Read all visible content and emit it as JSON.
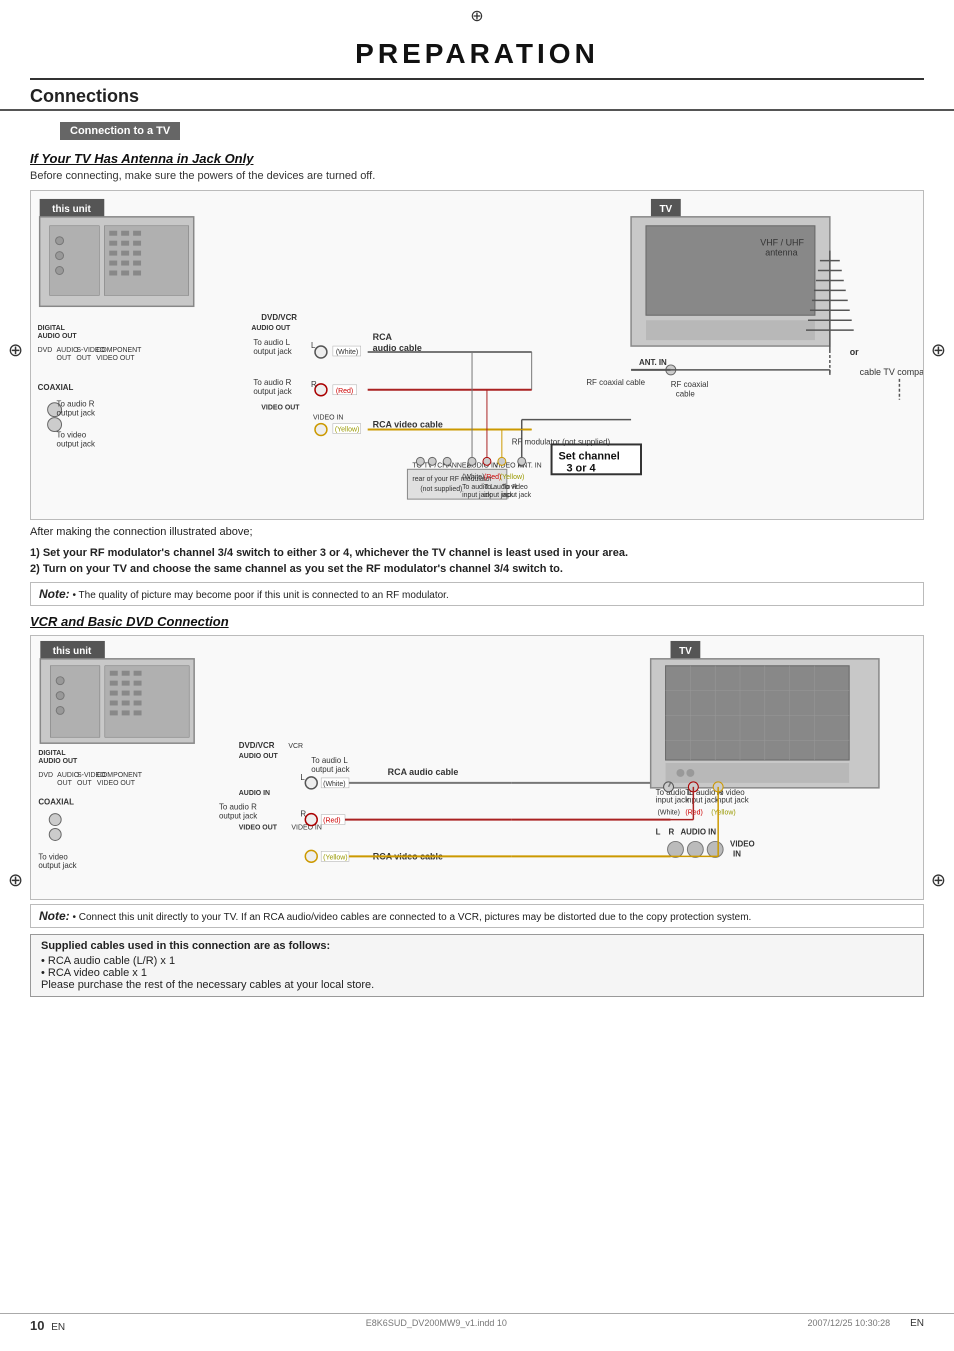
{
  "page": {
    "title": "PREPARATION",
    "registration_mark": "⊕"
  },
  "connections": {
    "heading": "Connections",
    "section_bar": "Connection to a TV",
    "section1": {
      "heading": "If Your TV Has Antenna in Jack Only",
      "subtitle": "Before connecting, make sure the powers of the devices are turned off.",
      "this_unit_label": "this unit",
      "tv_label": "TV",
      "labels": {
        "audio_l_out": "To audio L\noutput jack",
        "audio_r_out": "To audio R\noutput jack",
        "video_out": "To video\noutput jack",
        "rca_audio": "RCA\naudio cable",
        "rca_video": "RCA video cable",
        "rf_coaxial": "RF coaxial\ncable",
        "rf_modulator": "RF modulator (not supplied)",
        "rf_coaxial_cable": "RF coaxial\ncable",
        "vhf_uhf": "VHF / UHF\nantenna",
        "cable_company": "cable TV company",
        "or": "or",
        "set_channel": "Set channel\n3 or 4",
        "rear_modulator": "rear of your RF modulator\n(not supplied)",
        "ant_in": "ANT. IN",
        "to_channel": "TO TV / CHANNEL",
        "audio_in": "AUDIO IN",
        "video_in": "VIDEO IN",
        "audio_l_input": "To audio L\ninput jack",
        "audio_r_input": "To audio R\ninput jack",
        "video_input": "To video\ninput jack",
        "white_badge": "(White)",
        "red_badge": "(Red)",
        "yellow_badge": "(Yellow)",
        "dvd": "DVD",
        "dvd_vcr": "DVD/VCR",
        "digital_audio_out": "DIGITAL\nAUDIO OUT",
        "audio_out": "AUDIO\nOUT",
        "s_video_out": "S-VIDEO\nOUT",
        "component_video": "COMPONENT\nVIDEO OUT",
        "coaxial": "COAXIAL",
        "audio_in_label": "AUDIO IN",
        "video_out_label": "VIDEO OUT",
        "video_in_label": "VIDEO IN",
        "l_label": "L",
        "r_label": "R"
      }
    },
    "after_text": "After making the connection illustrated above;",
    "step1": "1) Set your RF modulator's channel 3/4 switch to either 3 or 4, whichever the TV channel is least used in your area.",
    "step2": "2) Turn on your TV and choose the same channel as you set the RF modulator's channel 3/4 switch to.",
    "note1": {
      "label": "Note:",
      "text": "• The quality of picture may become poor if this unit is connected to an RF modulator."
    },
    "section2": {
      "heading": "VCR and Basic DVD Connection",
      "this_unit_label": "this unit",
      "tv_label": "TV",
      "labels": {
        "audio_l_out": "To audio L\noutput jack",
        "audio_r_out": "To audio R\noutput jack",
        "video_out": "To video\noutput jack",
        "rca_audio": "RCA audio cable",
        "rca_video": "RCA video cable",
        "to_audio_l_input": "To audio L\ninput jack",
        "to_audio_r_input": "To audio R\ninput jack",
        "to_video_input": "To video\ninput jack",
        "audio_in_l": "L",
        "audio_in_r": "R",
        "audio_in_label": "AUDIO IN",
        "video_in_label": "VIDEO\nIN",
        "dvd": "DVD",
        "dvd_vcr_vcr": "DVD/VCR  VCR",
        "digital_audio_out": "DIGITAL\nAUDIO OUT",
        "audio_out": "AUDIO\nOUT",
        "s_video_out": "S-VIDEO\nOUT",
        "component": "COMPONENT\nVIDEO OUT",
        "coaxial": "COAXIAL",
        "audio_out2": "AUDIO OUT",
        "video_out2": "VIDEO OUT",
        "video_in2": "VIDEO IN",
        "white": "(White)",
        "red": "(Red)",
        "yellow": "(Yellow)"
      }
    },
    "note2": {
      "label": "Note:",
      "text": "• Connect this unit directly to your TV. If an RCA audio/video cables are connected to a VCR, pictures may be distorted due to the copy protection system."
    },
    "supplied_cables": {
      "title": "Supplied cables used in this connection are as follows:",
      "items": [
        "• RCA audio cable (L/R) x 1",
        "• RCA video cable x 1",
        "Please purchase the rest of the necessary cables at your local store."
      ]
    }
  },
  "footer": {
    "page_num": "10",
    "en1": "EN",
    "en2": "EN",
    "file": "E8K6SUD_DV200MW9_v1.indd  10",
    "date": "2007/12/25  10:30:28"
  }
}
